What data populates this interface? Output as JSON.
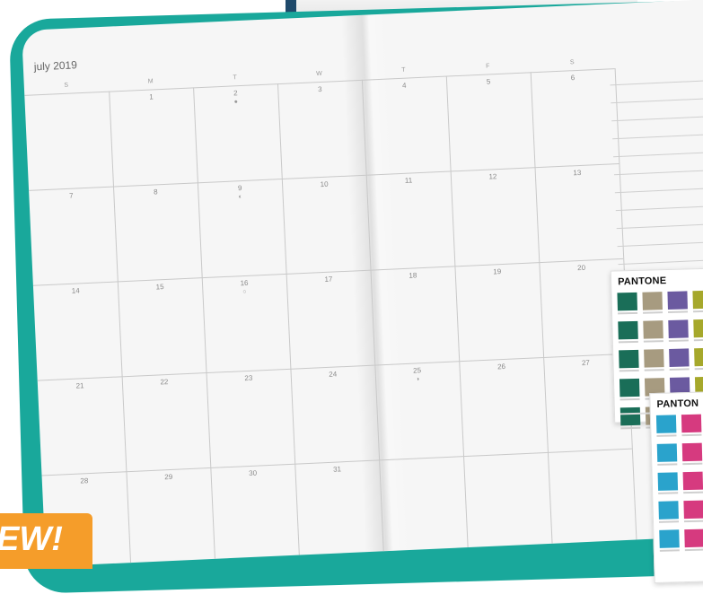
{
  "planner": {
    "month_label": "july 2019",
    "weekdays": [
      "S",
      "M",
      "T",
      "W",
      "T",
      "F",
      "S"
    ],
    "weeks": [
      [
        "",
        "1",
        "2",
        "3",
        "4",
        "5",
        "6"
      ],
      [
        "7",
        "8",
        "9",
        "10",
        "11",
        "12",
        "13"
      ],
      [
        "14",
        "15",
        "16",
        "17",
        "18",
        "19",
        "20"
      ],
      [
        "21",
        "22",
        "23",
        "24",
        "25",
        "26",
        "27"
      ],
      [
        "28",
        "29",
        "30",
        "31",
        "",
        "",
        ""
      ]
    ]
  },
  "swatch_cards": {
    "brand": "PANTONE",
    "brand_truncated": "PANTON",
    "card1_colors": [
      "#1a6e58",
      "#a79b80",
      "#6b5aa0",
      "#a6a82b"
    ],
    "card2_colors": [
      "#2aa3cc",
      "#d63a7f"
    ]
  },
  "badge": {
    "text": "EW!"
  },
  "colors": {
    "frame": "#19a89b",
    "badge": "#f59d2a",
    "binder": "#1f4a6b"
  }
}
